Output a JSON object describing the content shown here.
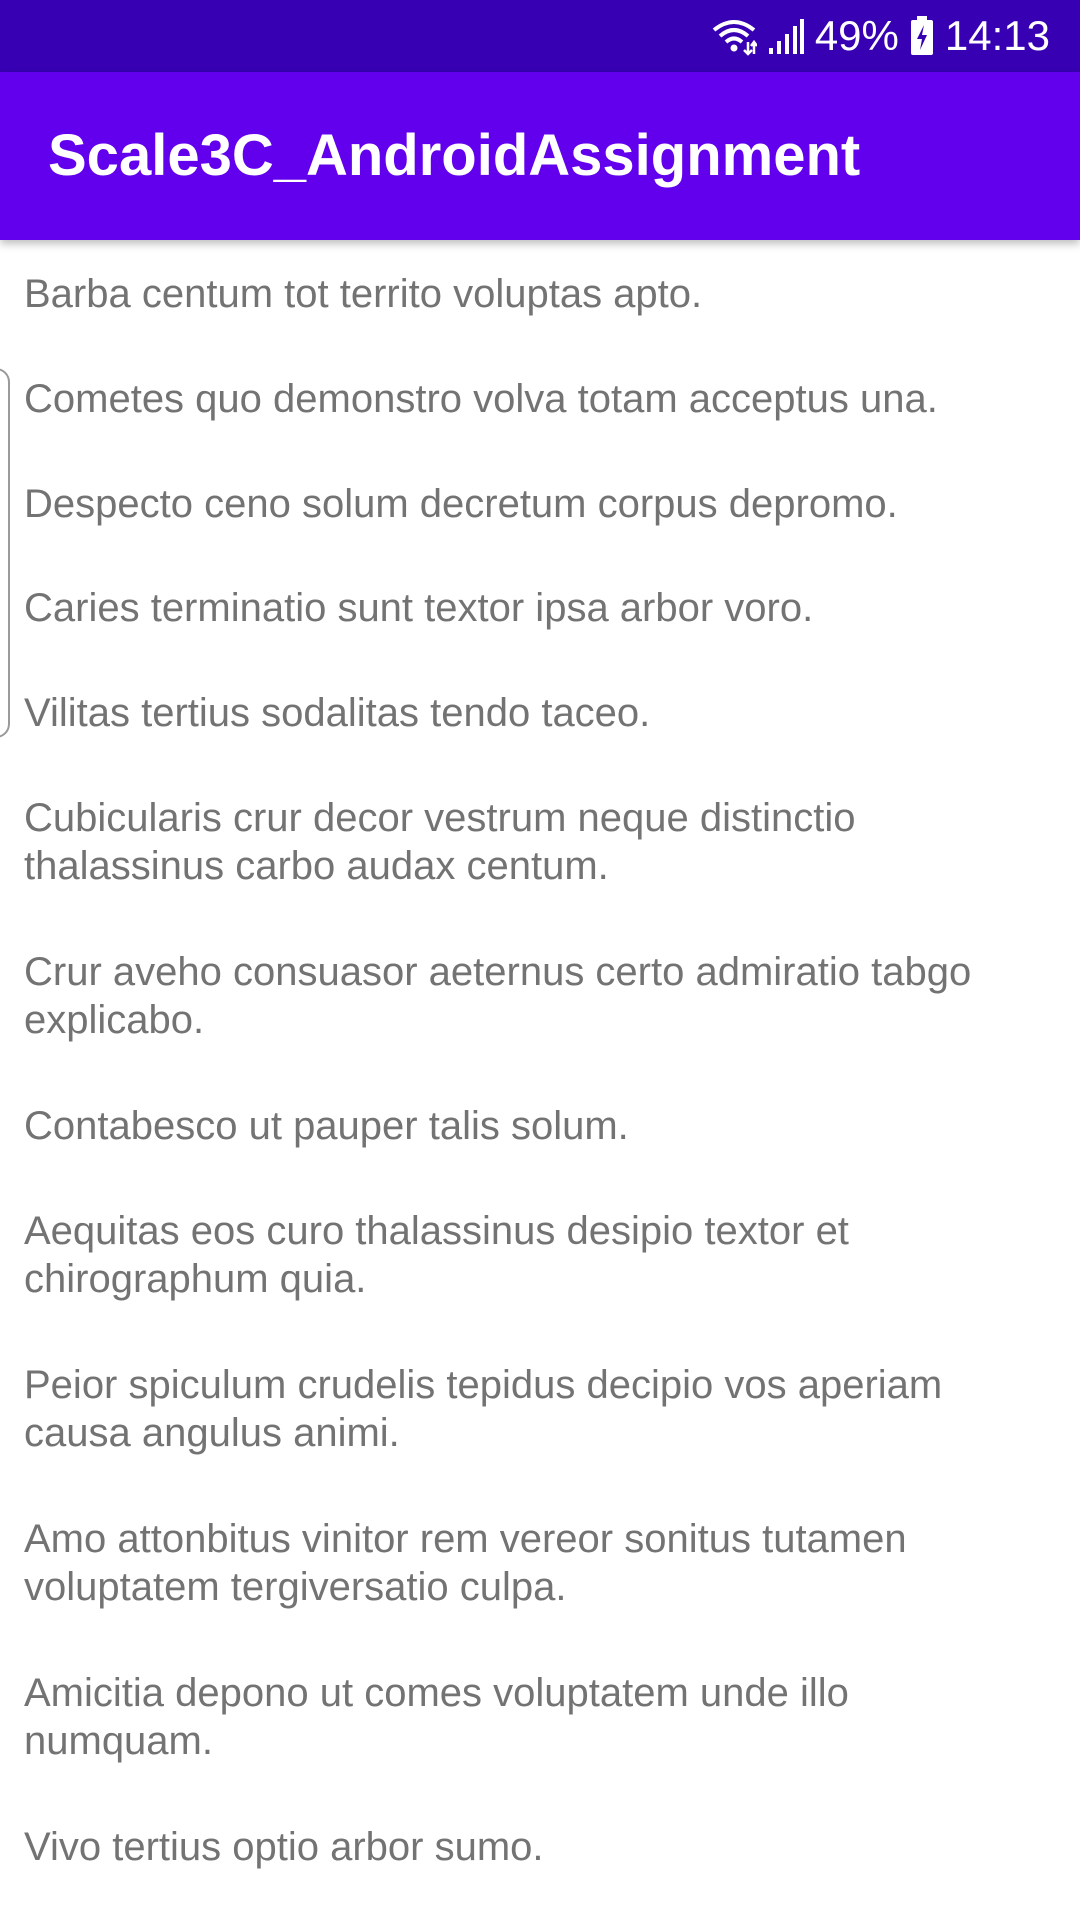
{
  "status_bar": {
    "battery_percent": "49%",
    "time": "14:13",
    "icons": [
      "wifi-icon",
      "signal-icon",
      "battery-icon"
    ],
    "background_color": "#3700b3"
  },
  "app_bar": {
    "title": "Scale3C_AndroidAssignment",
    "background_color": "#6200ee"
  },
  "items": [
    "Barba centum tot territo voluptas apto.",
    "Cometes quo demonstro volva totam acceptus una.",
    "Despecto ceno solum decretum corpus depromo.",
    "Caries terminatio sunt textor ipsa arbor voro.",
    "Vilitas tertius sodalitas tendo taceo.",
    "Cubicularis crur decor vestrum neque distinctio thalassinus carbo audax centum.",
    "Crur aveho consuasor aeternus certo admiratio tabgo explicabo.",
    "Contabesco ut pauper talis solum.",
    "Aequitas eos curo thalassinus desipio textor et chirographum quia.",
    "Peior spiculum crudelis tepidus decipio vos aperiam causa angulus animi.",
    "Amo attonbitus vinitor rem vereor sonitus tutamen voluptatem tergiversatio culpa.",
    "Amicitia depono ut comes voluptatem unde illo numquam.",
    "Vivo tertius optio arbor sumo."
  ]
}
